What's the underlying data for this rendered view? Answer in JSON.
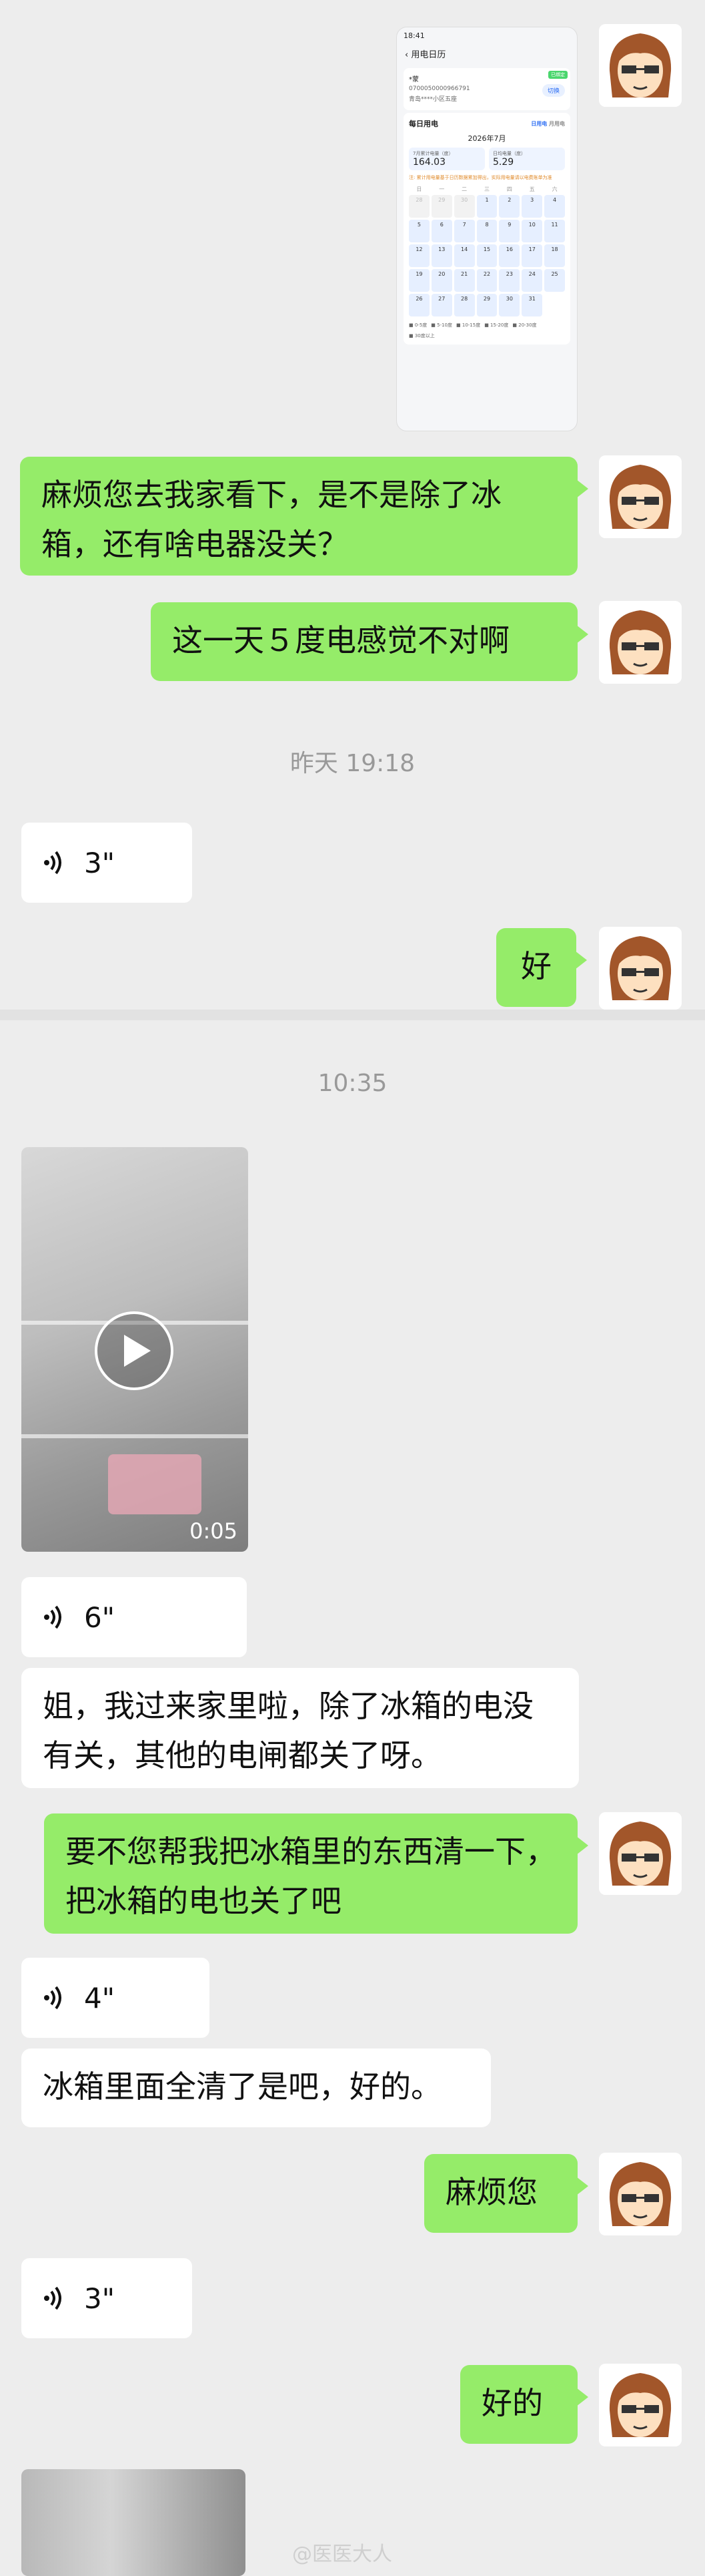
{
  "messages": {
    "m1": "麻烦您去我家看下，是不是除了冰箱，还有啥电器没关？",
    "m2": "这一天５度电感觉不对啊",
    "t1": "昨天 19:18",
    "v1": "3\"",
    "m3": "好",
    "t2": "10:35",
    "video_duration": "0:05",
    "v2": "6\"",
    "m4": "姐，我过来家里啦，除了冰箱的电没有关，其他的电闸都关了呀。",
    "m5": "要不您帮我把冰箱里的东西清一下，把冰箱的电也关了吧",
    "v3": "4\"",
    "m6": "冰箱里面全清了是吧，好的。",
    "m7": "麻烦您",
    "v4": "3\"",
    "m8": "好的"
  },
  "screenshot": {
    "status_time": "18:41",
    "title": "用电日历",
    "account_label": "*蒙",
    "account_number": "0700050000966791",
    "address": "青岛****小区五座",
    "switch_label": "切换",
    "tag": "已绑定",
    "section": "每日用电",
    "tab1": "日用电",
    "tab2": "月用电",
    "month": "2026年7月",
    "stat1_label": "7月累计电量（度）",
    "stat1_value": "164.03",
    "stat2_label": "日均电量（度）",
    "stat2_value": "5.29",
    "note": "注: 累计用电量基于日历数据累加得出，实际用电量请以电费账单为准",
    "weekdays": [
      "日",
      "一",
      "二",
      "三",
      "四",
      "五",
      "六"
    ],
    "legend": [
      "0-5度",
      "5-10度",
      "10-15度",
      "15-20度",
      "20-30度",
      "30度以上"
    ]
  },
  "watermark": "@医医大人",
  "colors": {
    "outgoing": "#95ec69",
    "incoming": "#ffffff",
    "background": "#ededed"
  }
}
